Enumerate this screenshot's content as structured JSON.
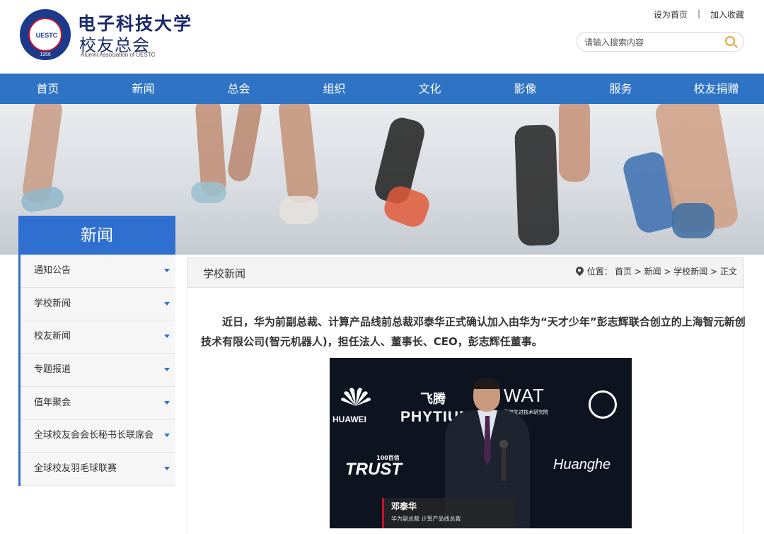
{
  "header": {
    "logo_cn": "电子科技大学",
    "logo_sub": "校友总会",
    "logo_en": "Alumni Association of UESTC",
    "emblem_text": "UESTC",
    "emblem_year": "1956",
    "set_home": "设为首页",
    "separator": "|",
    "add_fav": "加入收藏",
    "search_placeholder": "请输入搜索内容"
  },
  "nav": {
    "items": [
      "首页",
      "新闻",
      "总会",
      "组织",
      "文化",
      "影像",
      "服务",
      "校友捐赠"
    ]
  },
  "sidebar": {
    "title": "新闻",
    "items": [
      "通知公告",
      "学校新闻",
      "校友新闻",
      "专题报道",
      "值年聚会",
      "全球校友会会长秘书长联席会",
      "全球校友羽毛球联赛"
    ]
  },
  "content": {
    "section_title": "学校新闻",
    "breadcrumb": {
      "label": "位置：",
      "path": "首页 > 新闻 > 学校新闻 > 正文"
    },
    "paragraph": "近日，华为前副总裁、计算产品线前总裁邓泰华正式确认加入由华为“天才少年”彭志辉联合创立的上海智元新创技术有限公司(智元机器人)，担任法人、董事长、CEO，彭志辉任董事。",
    "photo": {
      "brands": [
        "HUAWEI",
        "飞腾",
        "PHYTIUM",
        "WAT",
        "无锡先进技术研究院",
        "TRUST",
        "100百信",
        "Huanghe"
      ],
      "caption_name": "邓泰华",
      "caption_role": "华为副总裁  计算产品线总裁"
    }
  }
}
